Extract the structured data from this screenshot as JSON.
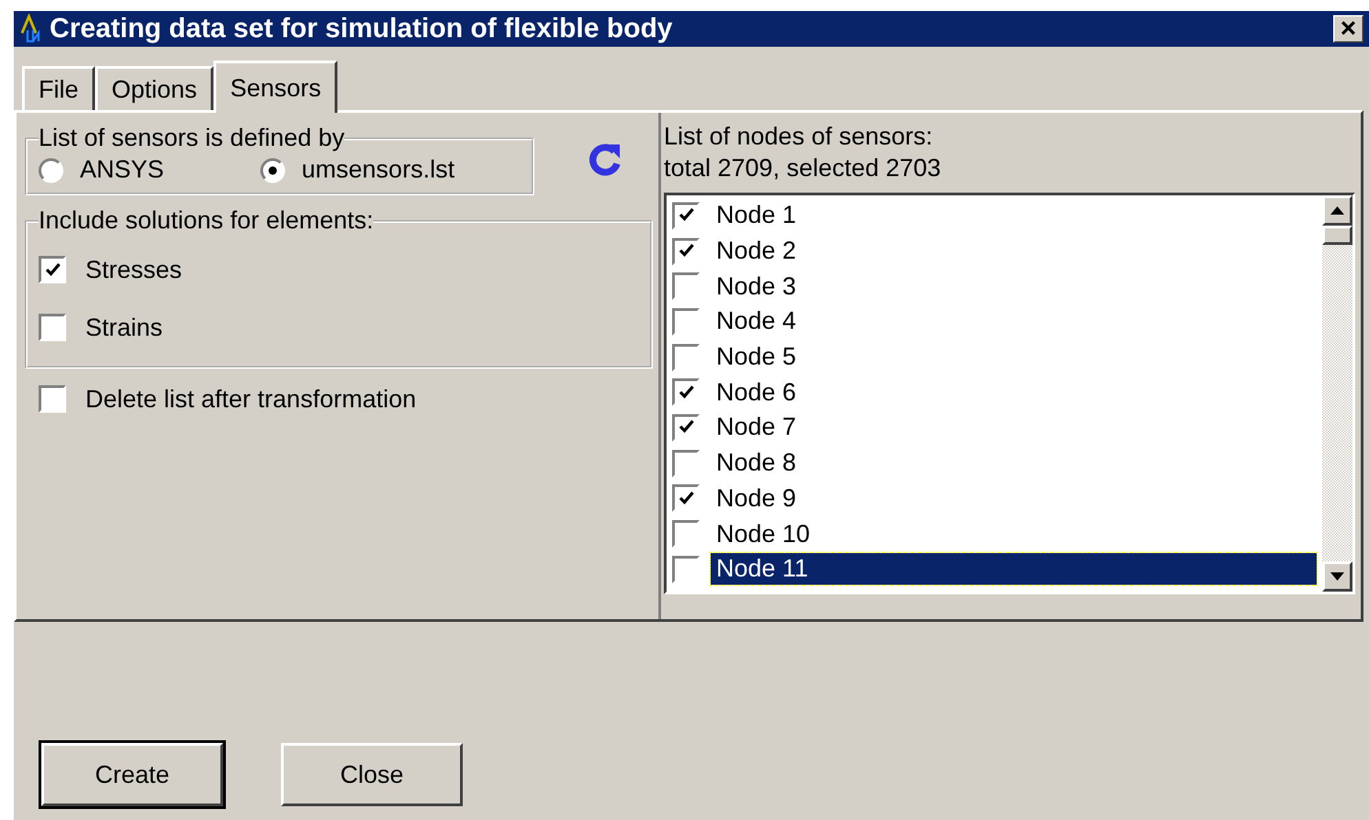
{
  "window": {
    "title": "Creating data set for simulation of flexible body",
    "close": "×"
  },
  "tabs": [
    {
      "label": "File",
      "selected": false
    },
    {
      "label": "Options",
      "selected": false
    },
    {
      "label": "Sensors",
      "selected": true
    }
  ],
  "sensor_source": {
    "legend": "List of sensors is defined by",
    "options": [
      {
        "label": "ANSYS",
        "selected": false
      },
      {
        "label": "umsensors.lst",
        "selected": true
      }
    ]
  },
  "solutions": {
    "legend": "Include solutions for elements:",
    "items": [
      {
        "label": "Stresses",
        "checked": true
      },
      {
        "label": "Strains",
        "checked": false
      }
    ]
  },
  "delete_option": {
    "label": "Delete list after transformation",
    "checked": false
  },
  "nodes": {
    "heading": "List of nodes of sensors:",
    "summary": "total 2709, selected 2703",
    "items": [
      {
        "label": "Node 1",
        "checked": true,
        "selected": false
      },
      {
        "label": "Node 2",
        "checked": true,
        "selected": false
      },
      {
        "label": "Node 3",
        "checked": false,
        "selected": false
      },
      {
        "label": "Node 4",
        "checked": false,
        "selected": false
      },
      {
        "label": "Node 5",
        "checked": false,
        "selected": false
      },
      {
        "label": "Node 6",
        "checked": true,
        "selected": false
      },
      {
        "label": "Node 7",
        "checked": true,
        "selected": false
      },
      {
        "label": "Node 8",
        "checked": false,
        "selected": false
      },
      {
        "label": "Node 9",
        "checked": true,
        "selected": false
      },
      {
        "label": "Node 10",
        "checked": false,
        "selected": false
      },
      {
        "label": "Node 11",
        "checked": false,
        "selected": true
      }
    ]
  },
  "buttons": [
    {
      "label": "Create",
      "default": true
    },
    {
      "label": "Close",
      "default": false
    }
  ]
}
